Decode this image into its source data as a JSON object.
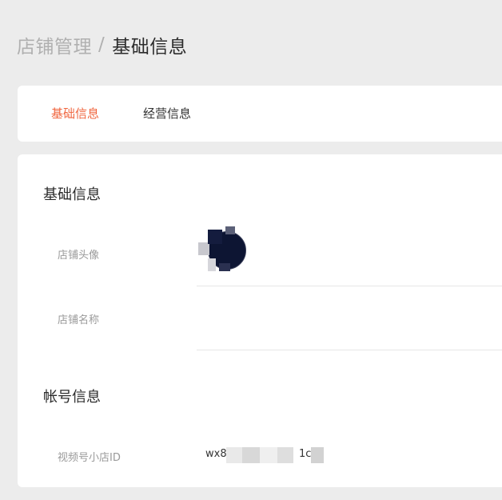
{
  "breadcrumb": {
    "parent": "店铺管理",
    "separator": "/",
    "current": "基础信息"
  },
  "tabs": [
    {
      "label": "基础信息",
      "active": true
    },
    {
      "label": "经营信息",
      "active": false
    }
  ],
  "sections": {
    "basic": {
      "title": "基础信息",
      "fields": {
        "avatar_label": "店铺头像",
        "name_label": "店铺名称",
        "name_value": ""
      }
    },
    "account": {
      "title": "帐号信息",
      "fields": {
        "id_label": "视频号小店ID",
        "id_value_prefix": "wx8",
        "id_value_suffix": "1c"
      }
    }
  },
  "colors": {
    "page_background": "#ececec",
    "card_background": "#ffffff",
    "accent": "#f0663f",
    "muted_text": "#9a9a9a",
    "avatar_dark": "#0d1533"
  }
}
